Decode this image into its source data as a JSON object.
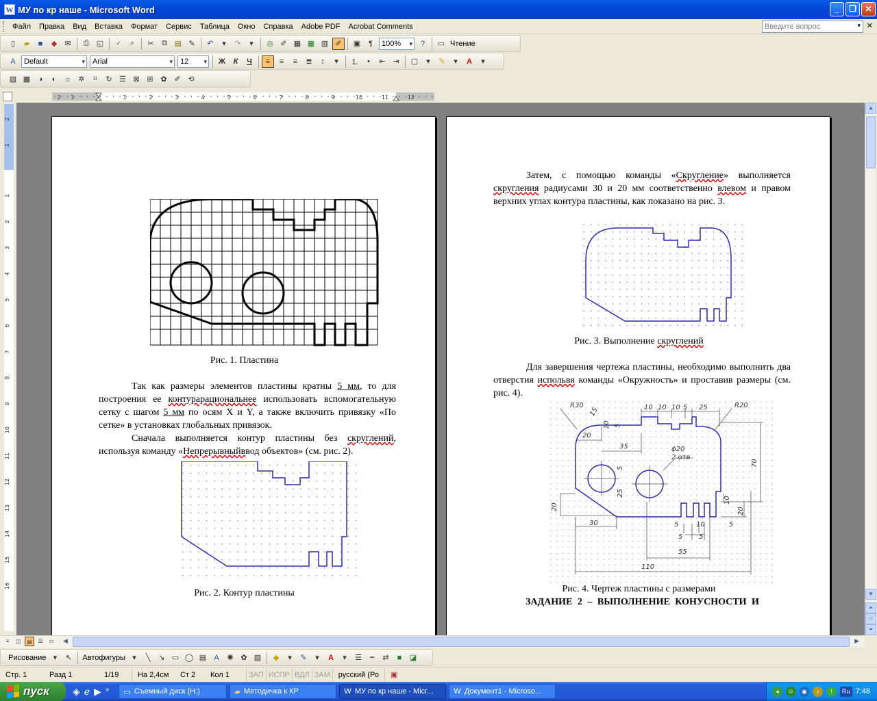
{
  "window": {
    "title": "МУ по кр наше - Microsoft Word",
    "app_icon": "W",
    "buttons": [
      "_",
      "❐",
      "✕"
    ]
  },
  "menu": {
    "items": [
      "Файл",
      "Правка",
      "Вид",
      "Вставка",
      "Формат",
      "Сервис",
      "Таблица",
      "Окно",
      "Справка",
      "Adobe PDF",
      "Acrobat Comments"
    ],
    "ask_placeholder": "Введите вопрос"
  },
  "toolbar_standard": {
    "zoom": "100%",
    "reading_label": "Чтение"
  },
  "toolbar_format": {
    "style": "Default",
    "font": "Arial",
    "size": "12",
    "bold": "Ж",
    "italic": "К",
    "underline": "Ч"
  },
  "ruler": {
    "h_labels": [
      "1",
      "2",
      "1",
      "2",
      "3",
      "4",
      "5",
      "6",
      "7",
      "8",
      "9",
      "10",
      "11",
      "12"
    ],
    "v_labels": [
      "2",
      "1",
      "1",
      "2",
      "3",
      "4",
      "5",
      "6",
      "7",
      "8",
      "9",
      "10",
      "11",
      "12",
      "13",
      "14",
      "15",
      "16"
    ]
  },
  "page_left": {
    "fig1_caption": "Рис. 1. Пластина",
    "para1_parts": [
      "Так как размеры элементов пластины кратны ",
      "5 мм",
      ", то для построения ее ",
      "контурарациональнее",
      " использовать вспомогательную сетку с шагом ",
      "5 мм",
      " по осям X и Y, а также включить привязку «По сетке» в установках глобальных привязок."
    ],
    "para2_parts": [
      "Сначала выполняется контур пластины без ",
      "скруглений",
      ", используя команду «",
      "Непрерывныйв",
      "вод объектов» (см. рис. 2)."
    ],
    "fig2_caption": "Рис. 2. Контур пластины"
  },
  "page_right": {
    "para1_parts": [
      "Затем, с помощью команды «",
      "Скругление",
      "» выполняется ",
      "скругления",
      " радиусами 30 и 20 мм соответственно ",
      "влевом",
      " и правом верхних углах контура пластины, как показано на рис. 3."
    ],
    "fig3_caption_parts": [
      "Рис. 3. Выполнение ",
      "скруглений"
    ],
    "para2_parts": [
      "Для завершения чертежа пластины, необходимо выполнить два отверстия ",
      "испольвя",
      " команды «Окружность» и проставив размеры (см. рис. 4)."
    ],
    "fig4_caption": "Рис. 4. Чертеж пластины с размерами",
    "heading": "ЗАДАНИЕ 2 – ВЫПОЛНЕНИЕ КОНУСНОСТИ И",
    "dims": {
      "r30": "R30",
      "r20": "R20",
      "d15": "15",
      "d10a": "10",
      "d10b": "10",
      "d10c": "10",
      "d5a": "5",
      "d25a": "25",
      "d20a": "20",
      "d35": "35",
      "phi20": "ϕ20",
      "two_holes": "2 отв",
      "d5b": "5",
      "d5c": "5",
      "d70": "70",
      "d25b": "25",
      "d20b": "20",
      "d20c": "20",
      "d10d": "10",
      "d30": "30",
      "d5d": "5",
      "d10e": "10",
      "d5e": "5",
      "d5f": "5",
      "d5g": "5",
      "d55": "55",
      "d110": "110",
      "d10f": "10"
    }
  },
  "drawbar": {
    "draw_label": "Рисование",
    "autoshapes_label": "Автофигуры"
  },
  "status": {
    "page": "Стр. 1",
    "section": "Разд 1",
    "pages": "1/19",
    "at": "На 2,4см",
    "line": "Ст 2",
    "col": "Кол 1",
    "rec": "ЗАП",
    "trk": "ИСПР",
    "ext": "ВДЛ",
    "ovr": "ЗАМ",
    "lang": "русский (Ро"
  },
  "taskbar": {
    "start": "пуск",
    "tasks": [
      "Съемный диск (H:)",
      "Методичка к КР",
      "МУ по кр наше - Micr...",
      "Документ1 - Microso..."
    ],
    "lang": "Ru",
    "clock": "7:48"
  },
  "colors": {
    "titlebar": "#0A5AE8",
    "taskbar": "#245EDB",
    "start": "#3C963C",
    "drawing_blue": "#2B2BB0",
    "dim_line": "#555555"
  }
}
